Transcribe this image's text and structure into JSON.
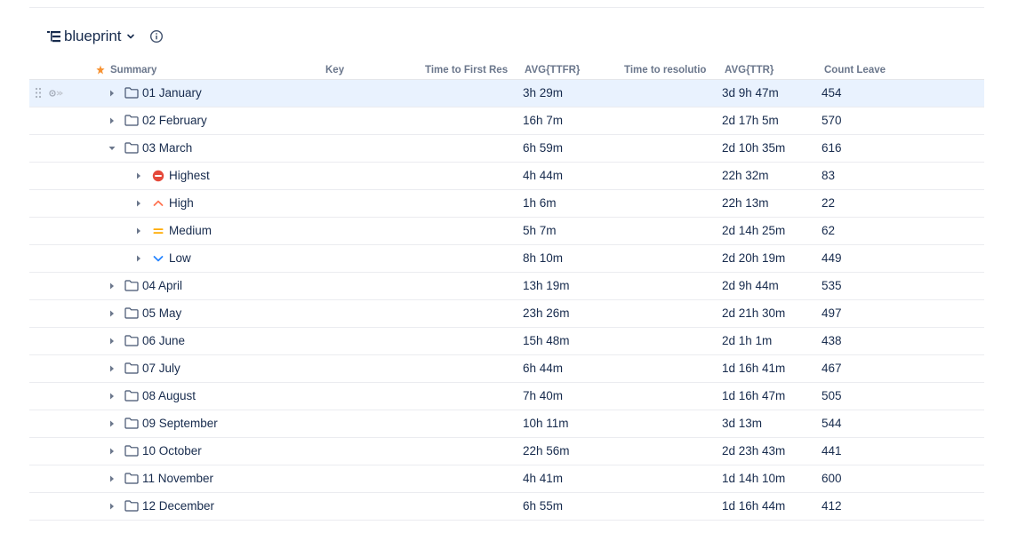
{
  "view": {
    "title": "blueprint"
  },
  "columns": {
    "summary": "Summary",
    "key": "Key",
    "ttfr": "Time to First Res",
    "avg_ttfr": "AVG{TTFR}",
    "ttr": "Time to resolutio",
    "avg_ttr": "AVG{TTR}",
    "count": "Count Leave"
  },
  "rows": [
    {
      "label": "01 January",
      "type": "folder",
      "avg_ttfr": "3h 29m",
      "avg_ttr": "3d 9h 47m",
      "count": "454",
      "expanded": false,
      "selected": true
    },
    {
      "label": "02 February",
      "type": "folder",
      "avg_ttfr": "16h 7m",
      "avg_ttr": "2d 17h 5m",
      "count": "570",
      "expanded": false
    },
    {
      "label": "03 March",
      "type": "folder",
      "avg_ttfr": "6h 59m",
      "avg_ttr": "2d 10h 35m",
      "count": "616",
      "expanded": true
    },
    {
      "label": "Highest",
      "type": "priority",
      "priority": "highest",
      "avg_ttfr": "4h 44m",
      "avg_ttr": "22h 32m",
      "count": "83"
    },
    {
      "label": "High",
      "type": "priority",
      "priority": "high",
      "avg_ttfr": "1h 6m",
      "avg_ttr": "22h 13m",
      "count": "22"
    },
    {
      "label": "Medium",
      "type": "priority",
      "priority": "medium",
      "avg_ttfr": "5h 7m",
      "avg_ttr": "2d 14h 25m",
      "count": "62"
    },
    {
      "label": "Low",
      "type": "priority",
      "priority": "low",
      "avg_ttfr": "8h 10m",
      "avg_ttr": "2d 20h 19m",
      "count": "449"
    },
    {
      "label": "04 April",
      "type": "folder",
      "avg_ttfr": "13h 19m",
      "avg_ttr": "2d 9h 44m",
      "count": "535"
    },
    {
      "label": "05 May",
      "type": "folder",
      "avg_ttfr": "23h 26m",
      "avg_ttr": "2d 21h 30m",
      "count": "497"
    },
    {
      "label": "06 June",
      "type": "folder",
      "avg_ttfr": "15h 48m",
      "avg_ttr": "2d 1h 1m",
      "count": "438"
    },
    {
      "label": "07 July",
      "type": "folder",
      "avg_ttfr": "6h 44m",
      "avg_ttr": "1d 16h 41m",
      "count": "467"
    },
    {
      "label": "08 August",
      "type": "folder",
      "avg_ttfr": "7h 40m",
      "avg_ttr": "1d 16h 47m",
      "count": "505"
    },
    {
      "label": "09 September",
      "type": "folder",
      "avg_ttfr": "10h 11m",
      "avg_ttr": "3d 13m",
      "count": "544"
    },
    {
      "label": "10 October",
      "type": "folder",
      "avg_ttfr": "22h 56m",
      "avg_ttr": "2d 23h 43m",
      "count": "441"
    },
    {
      "label": "11 November",
      "type": "folder",
      "avg_ttfr": "4h 41m",
      "avg_ttr": "1d 14h 10m",
      "count": "600"
    },
    {
      "label": "12 December",
      "type": "folder",
      "avg_ttfr": "6h 55m",
      "avg_ttr": "1d 16h 44m",
      "count": "412"
    }
  ],
  "colors": {
    "text": "#172b4d",
    "header_text": "#6b778c",
    "selected_row": "#e9f2fe",
    "divider": "#ebecf0",
    "priority_highest": "#e5493a",
    "priority_high": "#ff7452",
    "priority_medium": "#ffab00",
    "priority_low": "#2684ff"
  },
  "icons": {
    "view": "structure-view-icon",
    "dropdown": "chevron-down-icon",
    "info": "info-icon",
    "summary_star": "star-icon",
    "folder": "folder-icon",
    "expand": "caret-right-icon",
    "collapse": "caret-down-icon",
    "drag": "drag-handle-icon",
    "row_menu": "row-menu-icon"
  }
}
